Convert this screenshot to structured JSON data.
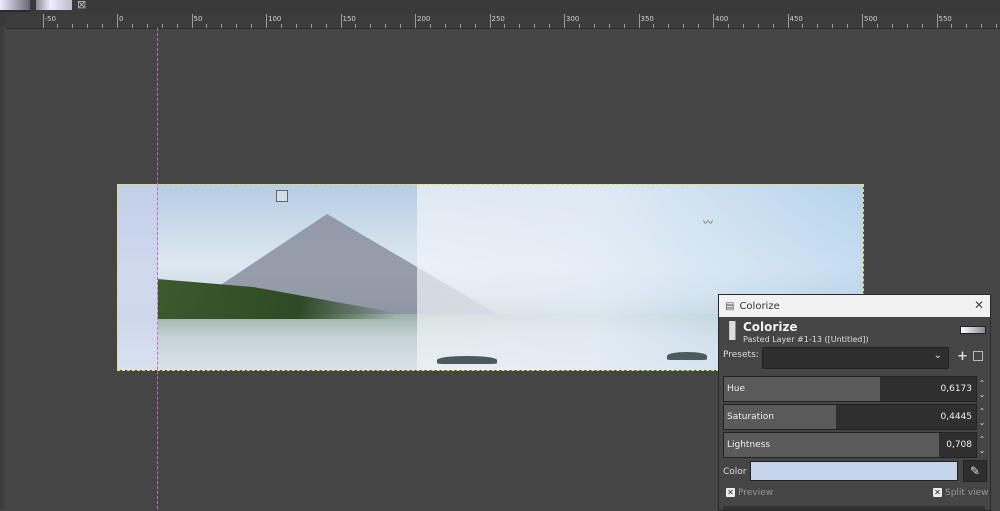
{
  "tabs": [
    {
      "name": "image-tab-1"
    },
    {
      "name": "image-tab-2",
      "close_glyph": "⊠"
    }
  ],
  "ruler": {
    "labels": [
      "-50",
      "0",
      "50",
      "100",
      "150",
      "200",
      "250",
      "300",
      "350",
      "400",
      "450",
      "500",
      "550"
    ]
  },
  "dialog": {
    "window_title": "Colorize",
    "close_glyph": "✕",
    "header_title": "Colorize",
    "header_subtitle": "Pasted Layer #1-13 ([Untitled])",
    "presets_label": "Presets:",
    "presets_value": "",
    "hue": {
      "label": "Hue",
      "value": "0,6173",
      "fraction": 0.6173
    },
    "saturation": {
      "label": "Saturation",
      "value": "0,4445",
      "fraction": 0.4445
    },
    "lightness": {
      "label": "Lightness",
      "value": "0,708",
      "fraction": 0.854
    },
    "color_label": "Color",
    "color_value": "#c6d4ea",
    "preview_label": "Preview",
    "split_label": "Split view"
  },
  "icons": {
    "dialog_icon": "paint-roller-icon",
    "picker_icon": "eyedropper-icon",
    "add_icon": "plus-icon",
    "menu_icon": "panel-menu-icon"
  }
}
